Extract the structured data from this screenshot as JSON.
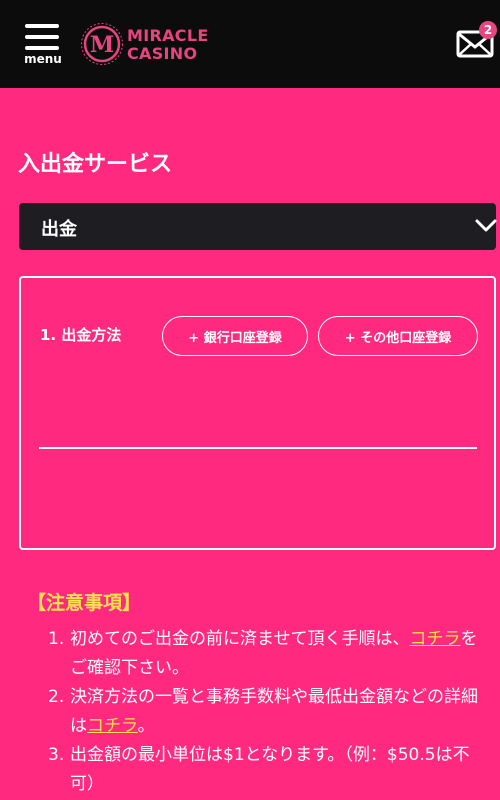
{
  "header": {
    "menu_label": "menu",
    "logo_line1": "MIRACLE",
    "logo_line2": "CASINO",
    "mail_count": "2",
    "colors": {
      "bar": "#0c0c0c",
      "brand": "#e8447f"
    }
  },
  "page": {
    "title": "入出金サービス",
    "background": "#ff2a7f"
  },
  "service_select": {
    "value": "出金"
  },
  "withdraw_form": {
    "method_label": "1. 出金方法",
    "bank_button": "+ 銀行口座登録",
    "other_button": "+ その他口座登録"
  },
  "notes": {
    "title": "【注意事項】",
    "item1_num": "1.",
    "item1_a": "初めてのご出金の前に済ませて頂く手順は、",
    "item1_link": "コチラ",
    "item1_b": "をご確認下さい。",
    "item2_num": "2.",
    "item2_a": "決済方法の一覧と事務手数料や最低出金額などの詳細は",
    "item2_link": "コチラ",
    "item2_b": "。",
    "item3_num": "3.",
    "item3_text": "出金額の最小単位は$1となります。（例：$50.5は不可）",
    "link_color": "#ffe14d"
  }
}
